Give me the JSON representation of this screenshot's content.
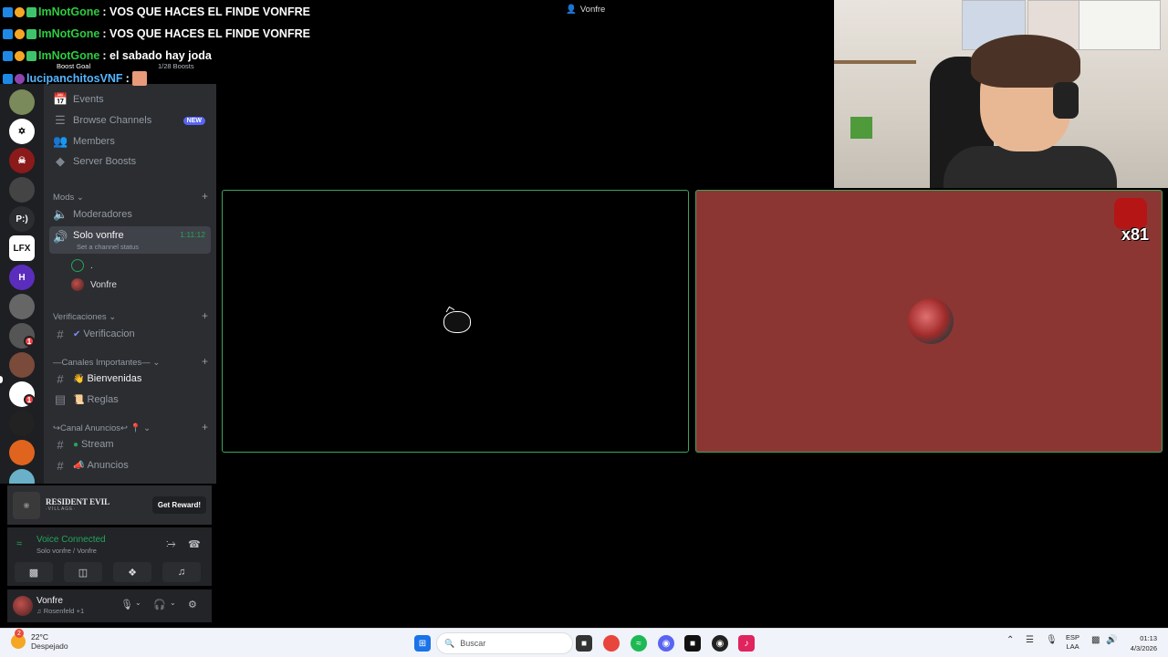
{
  "window": {
    "call_title": "Vonfre"
  },
  "chat": [
    {
      "user": "ImNotGone",
      "sep": ":",
      "message": "VOS QUE HACES EL FINDE VONFRE",
      "user_color": "green"
    },
    {
      "user": "ImNotGone",
      "sep": ":",
      "message": "VOS QUE HACES EL FINDE VONFRE",
      "user_color": "green"
    },
    {
      "user": "ImNotGone",
      "sep": ":",
      "message": "el sabado hay joda",
      "user_color": "green"
    },
    {
      "user": "lucipanchitosVNF",
      "sep": ":",
      "message": "",
      "user_color": "blue"
    }
  ],
  "boost": {
    "goal_label": "Boost Goal",
    "count": "1/28 Boosts"
  },
  "rail": {
    "servers": [
      "",
      "",
      "",
      "",
      "P:)",
      "LFX",
      "",
      "",
      "",
      "",
      "",
      "",
      "",
      ""
    ],
    "badges": [
      "1",
      "1"
    ]
  },
  "sidebar": {
    "top_items": [
      {
        "label": "Events",
        "icon": "calendar-icon"
      },
      {
        "label": "Browse Channels",
        "icon": "browse-icon",
        "badge": "NEW"
      },
      {
        "label": "Members",
        "icon": "members-icon"
      },
      {
        "label": "Server Boosts",
        "icon": "boost-icon"
      }
    ],
    "categories": {
      "mods": "Mods",
      "verificaciones": "Verificaciones",
      "importantes": "—Canales Importantes—",
      "anuncios": "↪Canal Anuncios↩"
    },
    "channels": {
      "moderadores": "Moderadores",
      "solo_vonfre": "Solo vonfre",
      "solo_vonfre_timer": "1:11:12",
      "solo_vonfre_status": "Set a channel status",
      "voice_users": [
        ".",
        "Vonfre"
      ],
      "verificacion": "Verificacion",
      "bienvenidas": "Bienvenidas",
      "reglas": "Reglas",
      "stream": "Stream",
      "anuncios": "Anuncios"
    }
  },
  "reward": {
    "title_line1": "RESIDENT EVIL",
    "title_line2": "·VILLAGE·",
    "button": "Get Reward!"
  },
  "voice": {
    "status": "Voice Connected",
    "location": "Solo vonfre / Vonfre"
  },
  "userbar": {
    "name": "Vonfre",
    "activity": "♫ Rosenfeld +1"
  },
  "tile": {
    "boost_counter": "x81"
  },
  "taskbar": {
    "temperature": "22°C",
    "weather": "Despejado",
    "search_placeholder": "Buscar",
    "notification_badge": "2",
    "lang_line1": "ESP",
    "lang_line2": "LAA",
    "time": "01:13",
    "date": "4/3/2026"
  },
  "colors": {
    "accent_green": "#23a55a",
    "tile_red": "#8c3634",
    "brand": "#5865f2"
  }
}
